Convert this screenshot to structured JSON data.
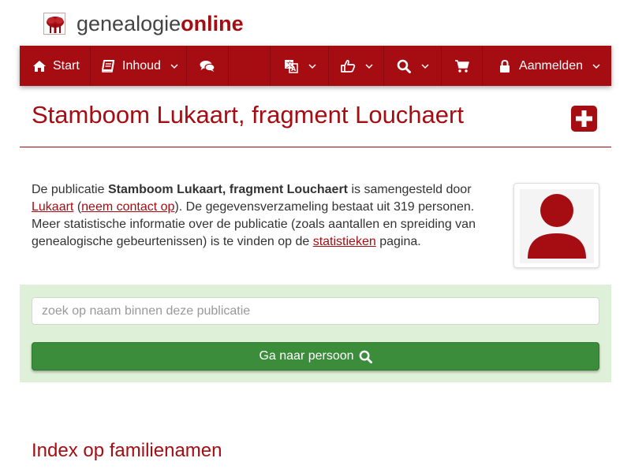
{
  "brand": {
    "name_regular": "genealogie",
    "name_bold": "online"
  },
  "nav": {
    "start": "Start",
    "inhoud": "Inhoud",
    "aanmelden": "Aanmelden",
    "icons": [
      "home-icon",
      "book-icon",
      "comments-icon",
      "language-icon",
      "thumbs-up-icon",
      "search-icon",
      "cart-icon",
      "lock-icon"
    ]
  },
  "page": {
    "title": "Stamboom Lukaart, fragment Louchaert"
  },
  "description": {
    "p1": "De publicatie ",
    "pub_name": "Stamboom Lukaart, fragment Louchaert",
    "p2": " is samengesteld door ",
    "author_link": "Lukaart",
    "p3": " (",
    "contact_link": "neem contact op",
    "p4": "). De gegevensverzameling bestaat uit 319 personen. Meer statistische informatie over de publicatie (zoals aantallen en spreiding van genealogische gebeurtenissen) is te vinden op de ",
    "stats_link": "statistieken",
    "p5": " pagina."
  },
  "search": {
    "placeholder": "zoek op naam binnen deze publicatie",
    "button_label": "Ga naar persoon"
  },
  "sections": {
    "index_title": "Index op familienamen"
  },
  "colors": {
    "brand_red": "#a50d12",
    "panel_green": "#dff0d8",
    "button_green": "#3b8d3b"
  }
}
